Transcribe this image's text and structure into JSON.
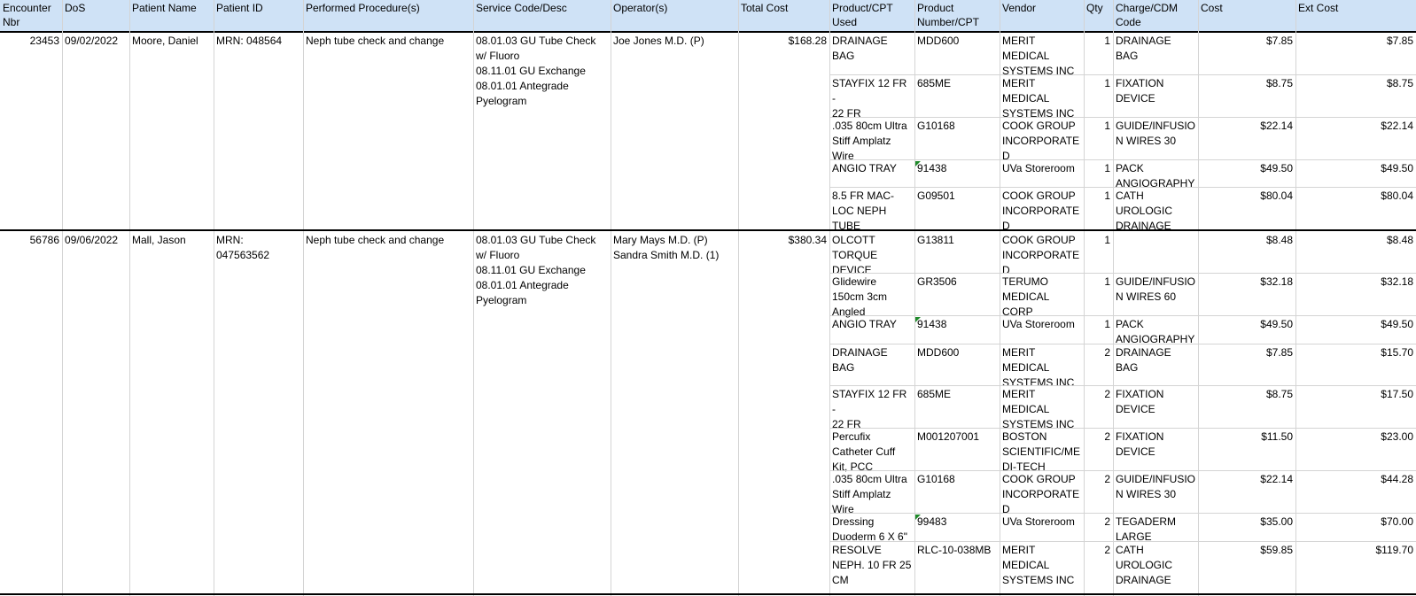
{
  "columns": [
    {
      "key": "enc",
      "label": "Encounter\nNbr"
    },
    {
      "key": "dos",
      "label": "DoS"
    },
    {
      "key": "name",
      "label": "Patient Name"
    },
    {
      "key": "pid",
      "label": "Patient ID"
    },
    {
      "key": "proc",
      "label": "Performed Procedure(s)"
    },
    {
      "key": "svc",
      "label": "Service Code/Desc"
    },
    {
      "key": "op",
      "label": "Operator(s)"
    },
    {
      "key": "total",
      "label": "Total Cost"
    },
    {
      "key": "prod",
      "label": "Product/CPT\nUsed"
    },
    {
      "key": "pnum",
      "label": "Product\nNumber/CPT"
    },
    {
      "key": "vendor",
      "label": "Vendor"
    },
    {
      "key": "qty",
      "label": "Qty"
    },
    {
      "key": "cdm",
      "label": "Charge/CDM\nCode"
    },
    {
      "key": "cost",
      "label": "Cost"
    },
    {
      "key": "ext",
      "label": "Ext Cost"
    }
  ],
  "encounters": [
    {
      "enc": "23453",
      "dos": "09/02/2022",
      "name": "Moore, Daniel",
      "pid": "MRN: 048564",
      "proc": "Neph tube check and change",
      "svc": "08.01.03 GU Tube Check\nw/ Fluoro\n08.11.01 GU Exchange\n08.01.01 Antegrade\nPyelogram",
      "op": "Joe Jones M.D. (P)",
      "total": "$168.28",
      "items": [
        {
          "prod": "DRAINAGE BAG",
          "pnum": "MDD600",
          "vendor": "MERIT MEDICAL\nSYSTEMS INC",
          "qty": "1",
          "cdm": "DRAINAGE BAG",
          "cost": "$7.85",
          "ext": "$7.85"
        },
        {
          "prod": "STAYFIX 12 FR -\n22 FR",
          "pnum": "685ME",
          "vendor": "MERIT MEDICAL\nSYSTEMS INC",
          "qty": "1",
          "cdm": "FIXATION\nDEVICE",
          "cost": "$8.75",
          "ext": "$8.75"
        },
        {
          "prod": ".035 80cm Ultra\nStiff Amplatz\nWire",
          "pnum": "G10168",
          "vendor": "COOK GROUP\nINCORPORATE\nD",
          "qty": "1",
          "cdm": "GUIDE/INFUSIO\nN WIRES 30",
          "cost": "$22.14",
          "ext": "$22.14"
        },
        {
          "prod": "ANGIO TRAY",
          "pnum": "91438",
          "vendor": "UVa Storeroom",
          "qty": "1",
          "cdm": "PACK\nANGIOGRAPHY",
          "cost": "$49.50",
          "ext": "$49.50"
        },
        {
          "prod": "8.5 FR MAC-\nLOC NEPH\nTUBE",
          "pnum": "G09501",
          "vendor": "COOK GROUP\nINCORPORATE\nD",
          "qty": "1",
          "cdm": "CATH\nUROLOGIC\nDRAINAGE",
          "cost": "$80.04",
          "ext": "$80.04"
        }
      ]
    },
    {
      "enc": "56786",
      "dos": "09/06/2022",
      "name": "Mall, Jason",
      "pid": "MRN:\n047563562",
      "proc": "Neph tube check and change",
      "svc": "08.01.03 GU Tube Check\nw/ Fluoro\n08.11.01 GU Exchange\n08.01.01 Antegrade\nPyelogram",
      "op": "Mary Mays M.D. (P)\nSandra Smith M.D. (1)",
      "total": "$380.34",
      "items": [
        {
          "prod": "OLCOTT\nTORQUE\nDEVICE",
          "pnum": "G13811",
          "vendor": "COOK GROUP\nINCORPORATE\nD",
          "qty": "1",
          "cdm": "",
          "cost": "$8.48",
          "ext": "$8.48"
        },
        {
          "prod": "Glidewire\n150cm 3cm\nAngled",
          "pnum": "GR3506",
          "vendor": "TERUMO\nMEDICAL CORP",
          "qty": "1",
          "cdm": "GUIDE/INFUSIO\nN WIRES 60",
          "cost": "$32.18",
          "ext": "$32.18"
        },
        {
          "prod": "ANGIO TRAY",
          "pnum": "91438",
          "vendor": "UVa Storeroom",
          "qty": "1",
          "cdm": "PACK\nANGIOGRAPHY",
          "cost": "$49.50",
          "ext": "$49.50"
        },
        {
          "prod": "DRAINAGE BAG",
          "pnum": "MDD600",
          "vendor": "MERIT MEDICAL\nSYSTEMS INC",
          "qty": "2",
          "cdm": "DRAINAGE BAG",
          "cost": "$7.85",
          "ext": "$15.70"
        },
        {
          "prod": "STAYFIX 12 FR -\n22 FR",
          "pnum": "685ME",
          "vendor": "MERIT MEDICAL\nSYSTEMS INC",
          "qty": "2",
          "cdm": "FIXATION\nDEVICE",
          "cost": "$8.75",
          "ext": "$17.50"
        },
        {
          "prod": "Percufix\nCatheter Cuff\nKit, PCC",
          "pnum": "M001207001",
          "vendor": "BOSTON\nSCIENTIFIC/ME\nDI-TECH",
          "qty": "2",
          "cdm": "FIXATION\nDEVICE",
          "cost": "$11.50",
          "ext": "$23.00"
        },
        {
          "prod": ".035 80cm Ultra\nStiff Amplatz\nWire",
          "pnum": "G10168",
          "vendor": "COOK GROUP\nINCORPORATE\nD",
          "qty": "2",
          "cdm": "GUIDE/INFUSIO\nN WIRES 30",
          "cost": "$22.14",
          "ext": "$44.28"
        },
        {
          "prod": "Dressing\nDuoderm 6 X 6\"",
          "pnum": "99483",
          "vendor": "UVa Storeroom",
          "qty": "2",
          "cdm": "TEGADERM\nLARGE",
          "cost": "$35.00",
          "ext": "$70.00"
        },
        {
          "prod": "RESOLVE\nNEPH. 10 FR 25\nCM",
          "pnum": "RLC-10-038MB",
          "vendor": "MERIT MEDICAL\nSYSTEMS INC",
          "qty": "2",
          "cdm": "CATH\nUROLOGIC\nDRAINAGE",
          "cost": "$59.85",
          "ext": "$119.70"
        }
      ]
    }
  ]
}
